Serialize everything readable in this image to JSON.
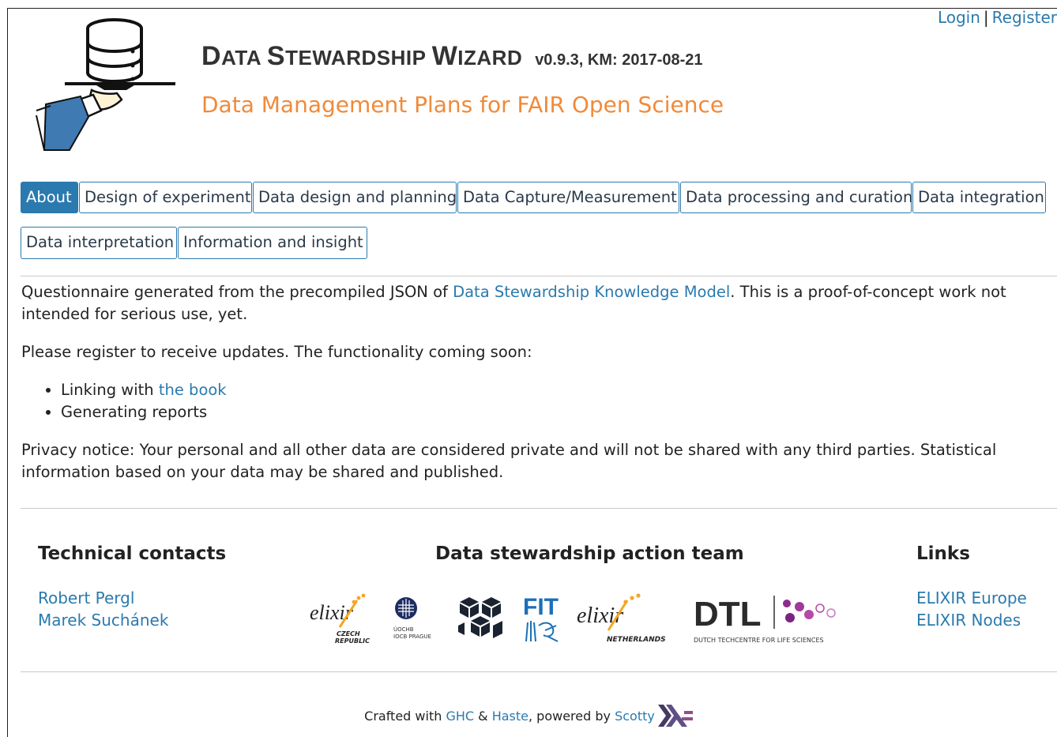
{
  "auth": {
    "login": "Login",
    "separator": "|",
    "register": "Register"
  },
  "header": {
    "title_parts": [
      {
        "cap": "D",
        "rest": "ATA "
      },
      {
        "cap": "S",
        "rest": "TEWARDSHIP "
      },
      {
        "cap": "W",
        "rest": "IZARD"
      }
    ],
    "version": "v0.9.3, KM: 2017-08-21",
    "subtitle": "Data Management Plans for FAIR Open Science"
  },
  "tabs": [
    {
      "label": "About",
      "active": true
    },
    {
      "label": "Design of experiment",
      "active": false
    },
    {
      "label": "Data design and planning",
      "active": false
    },
    {
      "label": "Data Capture/Measurement",
      "active": false
    },
    {
      "label": "Data processing and curation",
      "active": false
    },
    {
      "label": "Data integration",
      "active": false
    },
    {
      "label": "Data interpretation",
      "active": false
    },
    {
      "label": "Information and insight",
      "active": false
    }
  ],
  "content": {
    "p1_before": "Questionnaire generated from the precompiled JSON of ",
    "p1_link": "Data Stewardship Knowledge Model",
    "p1_after": ". This is a proof-of-concept work not intended for serious use, yet.",
    "p2": "Please register to receive updates. The functionality coming soon:",
    "bullet1_text": "Linking with ",
    "bullet1_link": "the book",
    "bullet2": "Generating reports",
    "privacy": "Privacy notice: Your personal and all other data are considered private and will not be shared with any third parties. Statistical information based on your data may be shared and published."
  },
  "footer": {
    "contacts_heading": "Technical contacts",
    "contacts": [
      "Robert Pergl",
      "Marek Suchánek"
    ],
    "team_heading": "Data stewardship action team",
    "links_heading": "Links",
    "links": [
      "ELIXIR Europe",
      "ELIXIR Nodes"
    ],
    "partners": {
      "elixir_cz": {
        "word": "elixir",
        "sub1": "CZECH",
        "sub2": "REPUBLIC"
      },
      "uochb": {
        "line1": "ÚOCHB",
        "line2": "IOCB PRAGUE"
      },
      "fit": {
        "word": "FIT"
      },
      "elixir_nl": {
        "word": "elixir",
        "sub": "NETHERLANDS"
      },
      "dtl": {
        "word": "DTL",
        "sub": "DUTCH TECHCENTRE FOR LIFE SCIENCES"
      }
    }
  },
  "bottom": {
    "crafted": "Crafted with ",
    "ghc": "GHC",
    "amp": " & ",
    "haste": "Haste",
    "powered": ", powered by ",
    "scotty": "Scotty"
  },
  "colors": {
    "accent": "#2a7aaf",
    "subtitle": "#f08a3a",
    "elixir_orange": "#f5a623",
    "dtl_purple": "#8e2b8e",
    "fit_blue": "#1c6fb8"
  }
}
